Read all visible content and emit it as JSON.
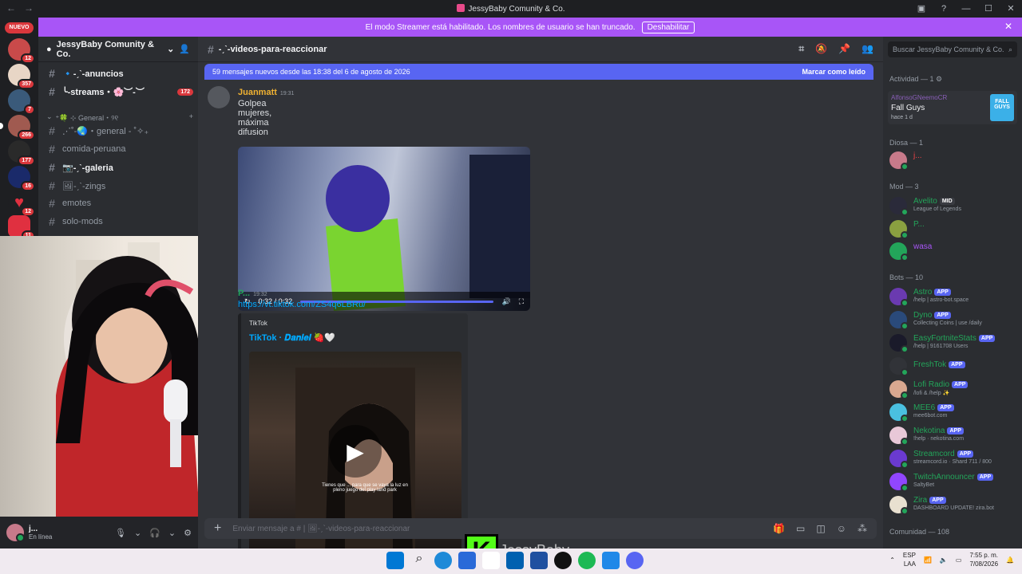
{
  "window": {
    "title": "JessyBaby Comunity & Co."
  },
  "banner": {
    "text": "El modo Streamer está habilitado. Los nombres de usuario se han truncado.",
    "button": "Deshabilitar"
  },
  "guilds": {
    "new_label": "NUEVO",
    "badges": [
      "12",
      "357",
      "7",
      "266",
      "177",
      "16",
      "12",
      "11"
    ]
  },
  "server": {
    "name": "JessyBaby Comunity & Co."
  },
  "channels": [
    {
      "name": "🔹-ˏˋ-anuncios",
      "unread": true
    },
    {
      "name": "╰-streams・🌸︶-︶",
      "unread": true,
      "badge": "172"
    },
    {
      "name": "⋰˚-🌏・general - ˚✧₊",
      "unread": false
    },
    {
      "name": "comida-peruana",
      "unread": false
    },
    {
      "name": "📷-ˏˋ-galeria",
      "unread": true
    },
    {
      "name": "🖼-ˏˋ-zings",
      "unread": false
    },
    {
      "name": "emotes",
      "unread": false
    },
    {
      "name": "solo-mods",
      "unread": false
    }
  ],
  "category": {
    "name": "⁺🍀 ⊹ General・୨୧"
  },
  "user": {
    "name": "j...",
    "status": "En línea"
  },
  "header": {
    "channel": "-ˏˋ-videos-para-reaccionar"
  },
  "new_messages": {
    "text": "59 mensajes nuevos desde las 18:38 del 6 de agosto de 2026",
    "action": "Marcar como leído"
  },
  "messages": [
    {
      "author": "Juanmatt",
      "time": "19:31",
      "text": "Golpea mujeres, máxima difusion",
      "video_time": "0:32 / 0:32"
    },
    {
      "author": "P...",
      "time": "19:32",
      "link": "https://vt.tiktok.com/ZS4q6LBRu/",
      "embed_provider": "TikTok",
      "embed_title": "TikTok · 𝑫𝒂𝒏𝒊𝒆𝒍 🍓🤍",
      "caption": "Tienes que ... para que se vaya la luz en pleno juego del play land park"
    }
  ],
  "composer": {
    "placeholder": "Enviar mensaje a # | 🖼-ˏˋ-videos-para-reaccionar"
  },
  "members": {
    "search": "Buscar JessyBaby Comunity & Co.",
    "activity_header": "Actividad — 1",
    "activity": {
      "user": "AlfonsoGNeemoCR",
      "game": "Fall Guys",
      "since": "hace 1 d",
      "art": "FALL GUYS"
    },
    "groups": [
      {
        "title": "Diosa — 1",
        "items": [
          {
            "name": "j...",
            "sub": "",
            "color": "#ed4245"
          }
        ]
      },
      {
        "title": "Mod — 3",
        "items": [
          {
            "name": "Avelito",
            "sub": "League of Legends",
            "tag": "MID",
            "color": "#23a55a"
          },
          {
            "name": "P...",
            "sub": "",
            "color": "#23a55a"
          },
          {
            "name": "wasa",
            "sub": "",
            "color": "#a855f7"
          }
        ]
      },
      {
        "title": "Bots — 10",
        "items": [
          {
            "name": "Astro",
            "sub": "/help | astro-bot.space",
            "tag": "APP"
          },
          {
            "name": "Dyno",
            "sub": "Collecting Coins | use /daily",
            "tag": "APP"
          },
          {
            "name": "EasyFortniteStats",
            "sub": "/help | 9161708 Users",
            "tag": "APP"
          },
          {
            "name": "FreshTok",
            "sub": "",
            "tag": "APP"
          },
          {
            "name": "Lofi Radio",
            "sub": "/lofi & /help ✨",
            "tag": "APP"
          },
          {
            "name": "MEE6",
            "sub": "mee6bot.com",
            "tag": "APP"
          },
          {
            "name": "Nekotina",
            "sub": "!help · nekotina.com",
            "tag": "APP"
          },
          {
            "name": "Streamcord",
            "sub": "streamcord.io · Shard 711 / 800",
            "tag": "APP"
          },
          {
            "name": "TwitchAnnouncer",
            "sub": "SaltyBet",
            "tag": "APP"
          },
          {
            "name": "Zira",
            "sub": "DASHBOARD UPDATE! zira.bot",
            "tag": "APP"
          }
        ]
      },
      {
        "title": "Comunidad — 108",
        "items": []
      }
    ]
  },
  "overlay": {
    "text": "JessyBaby"
  },
  "taskbar": {
    "lang": "ESP",
    "region": "LAA",
    "time": "7:55 p. m.",
    "date": "7/08/2026"
  },
  "colors": {
    "accent": "#5865f2",
    "streamer_banner": "#a855f7",
    "online": "#23a55a",
    "badge": "#da373c"
  }
}
